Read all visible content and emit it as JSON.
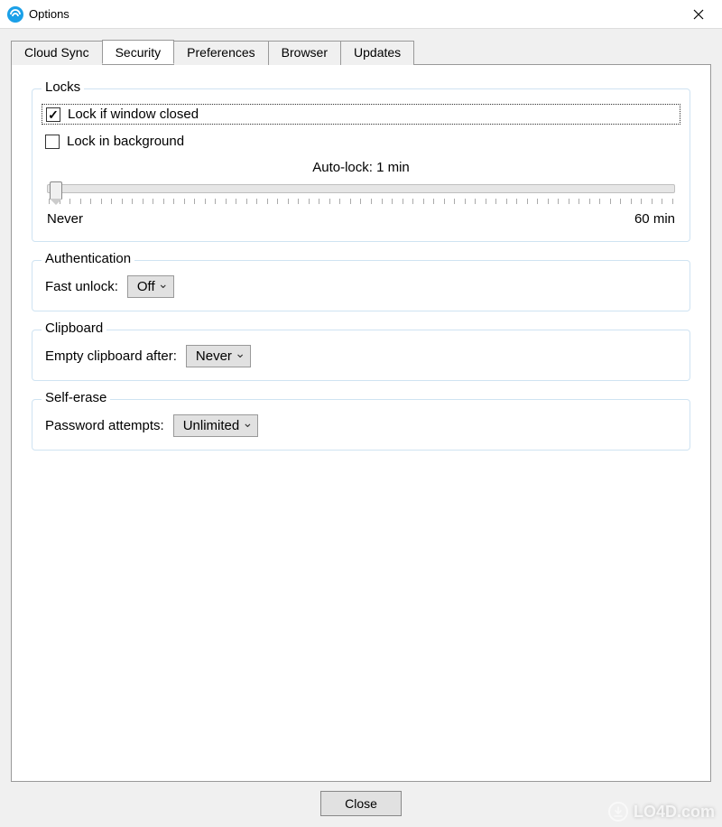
{
  "window": {
    "title": "Options"
  },
  "tabs": [
    {
      "label": "Cloud Sync"
    },
    {
      "label": "Security"
    },
    {
      "label": "Preferences"
    },
    {
      "label": "Browser"
    },
    {
      "label": "Updates"
    }
  ],
  "locks": {
    "legend": "Locks",
    "lock_window_closed_label": "Lock if window closed",
    "lock_window_closed_checked": true,
    "lock_in_background_label": "Lock in background",
    "lock_in_background_checked": false,
    "autolock_label": "Auto-lock: 1 min",
    "slider_min_label": "Never",
    "slider_max_label": "60 min",
    "slider_value": 1,
    "slider_min": 0,
    "slider_max": 60
  },
  "auth": {
    "legend": "Authentication",
    "fast_unlock_label": "Fast unlock:",
    "fast_unlock_value": "Off"
  },
  "clipboard": {
    "legend": "Clipboard",
    "empty_after_label": "Empty clipboard after:",
    "empty_after_value": "Never"
  },
  "self_erase": {
    "legend": "Self-erase",
    "attempts_label": "Password attempts:",
    "attempts_value": "Unlimited"
  },
  "footer": {
    "close_label": "Close"
  },
  "watermark": {
    "text": "LO4D.com"
  }
}
